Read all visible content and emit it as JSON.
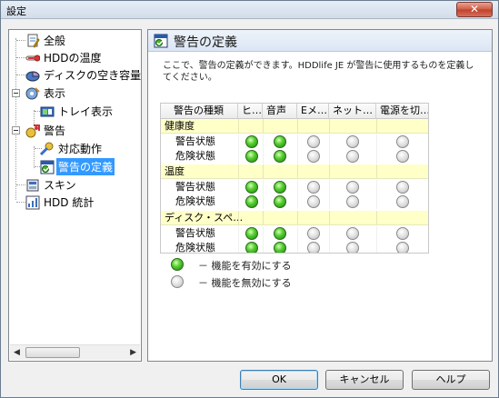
{
  "window": {
    "title": "設定",
    "close_label": "✕"
  },
  "tree": {
    "items": [
      {
        "label": "全般"
      },
      {
        "label": "HDDの温度"
      },
      {
        "label": "ディスクの空き容量"
      },
      {
        "label": "表示"
      },
      {
        "label": "トレイ表示"
      },
      {
        "label": "警告"
      },
      {
        "label": "対応動作"
      },
      {
        "label": "警告の定義"
      },
      {
        "label": "スキン"
      },
      {
        "label": "HDD 統計"
      }
    ],
    "selected": "警告の定義"
  },
  "panel": {
    "title": "警告の定義",
    "description": "ここで、警告の定義ができます。HDDlife JE が警告に使用するものを定義してください。"
  },
  "table": {
    "columns": [
      "警告の種類",
      "ヒ…",
      "音声",
      "Eメ…",
      "ネット…",
      "電源を切…"
    ],
    "groups": [
      {
        "name": "健康度",
        "rows": [
          {
            "label": "警告状態",
            "states": [
              true,
              true,
              false,
              false,
              false
            ]
          },
          {
            "label": "危険状態",
            "states": [
              true,
              true,
              false,
              false,
              false
            ]
          }
        ]
      },
      {
        "name": "温度",
        "rows": [
          {
            "label": "警告状態",
            "states": [
              true,
              true,
              false,
              false,
              false
            ]
          },
          {
            "label": "危険状態",
            "states": [
              true,
              true,
              false,
              false,
              false
            ]
          }
        ]
      },
      {
        "name": "ディスク・スペ…",
        "rows": [
          {
            "label": "警告状態",
            "states": [
              true,
              true,
              false,
              false,
              false
            ]
          },
          {
            "label": "危険状態",
            "states": [
              true,
              true,
              false,
              false,
              false
            ]
          }
        ]
      }
    ]
  },
  "legend": {
    "enabled": "－ 機能を有効にする",
    "disabled": "－ 機能を無効にする"
  },
  "buttons": {
    "ok": "OK",
    "cancel": "キャンセル",
    "help": "ヘルプ"
  },
  "colors": {
    "selection": "#3399ff",
    "group_row": "#ffffc8",
    "led_on": "#3fb81f"
  }
}
